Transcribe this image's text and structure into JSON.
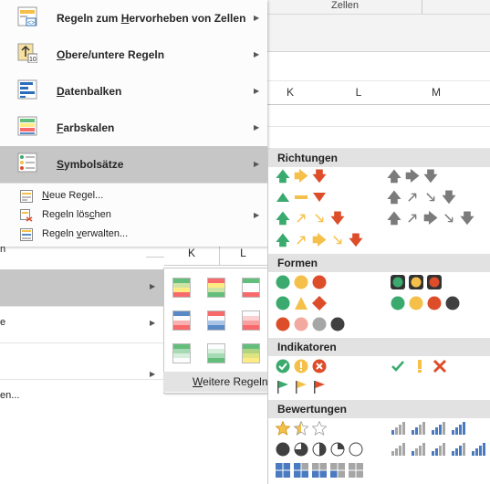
{
  "background": {
    "ribbon_group": "Zellen",
    "columns": [
      "K",
      "L",
      "M"
    ],
    "behind_columns": [
      "K",
      "L"
    ],
    "behind_menu_text": [
      "n",
      "e",
      "en..."
    ]
  },
  "menu": {
    "items": [
      {
        "label": "Regeln zum Hervorheben von Zellen",
        "key": "H",
        "icon": "highlight-rules-icon"
      },
      {
        "label": "Obere/untere Regeln",
        "key": "O",
        "icon": "top-bottom-rules-icon"
      },
      {
        "label": "Datenbalken",
        "key": "D",
        "icon": "data-bars-icon"
      },
      {
        "label": "Farbskalen",
        "key": "F",
        "icon": "color-scales-icon"
      },
      {
        "label": "Symbolsätze",
        "key": "S",
        "icon": "icon-sets-icon",
        "selected": true
      }
    ],
    "small_items": [
      {
        "label": "Neue Regel...",
        "icon": "new-rule-icon"
      },
      {
        "label": "Regeln löschen",
        "icon": "clear-rules-icon",
        "submenu": true
      },
      {
        "label": "Regeln verwalten...",
        "icon": "manage-rules-icon"
      }
    ]
  },
  "color_scales": {
    "more_label": "Weitere Regeln",
    "colors": {
      "green": "#63be7b",
      "yellow": "#ffeb84",
      "red": "#f8696b",
      "blue": "#5a8ac6",
      "white": "#fcfcff"
    }
  },
  "icon_sets": {
    "sections": [
      "Richtungen",
      "Formen",
      "Indikatoren",
      "Bewertungen"
    ],
    "colors": {
      "green": "#3aaa6e",
      "yellow": "#f5c04a",
      "red": "#dd4d2a",
      "gray": "#7b7b7b",
      "black": "#404040",
      "blue": "#4a7ac0"
    }
  }
}
